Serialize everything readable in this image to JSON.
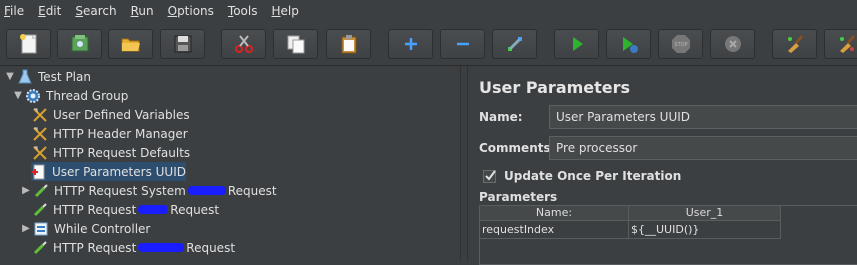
{
  "menu": [
    {
      "mn": "F",
      "rest": "ile"
    },
    {
      "mn": "E",
      "rest": "dit"
    },
    {
      "mn": "S",
      "rest": "earch"
    },
    {
      "mn": "R",
      "rest": "un"
    },
    {
      "mn": "O",
      "rest": "ptions"
    },
    {
      "mn": "T",
      "rest": "ools"
    },
    {
      "mn": "H",
      "rest": "elp"
    }
  ],
  "toolbar_icons": [
    "new-icon",
    "templates-icon",
    "open-icon",
    "save-icon",
    "cut-icon",
    "copy-icon",
    "paste-icon",
    "expand-icon",
    "collapse-icon",
    "toggle-icon",
    "start-icon",
    "start-no-pauses-icon",
    "stop-icon",
    "shutdown-icon",
    "clear-icon",
    "clear-all-icon"
  ],
  "tree": {
    "test_plan": "Test Plan",
    "thread_group": "Thread Group",
    "udv": "User Defined Variables",
    "header_manager": "HTTP Header Manager",
    "request_defaults": "HTTP Request Defaults",
    "user_params": "User Parameters UUID",
    "req1_a": "HTTP Request System ",
    "req1_b": "Request",
    "req2_a": "HTTP Request ",
    "req2_b": "Request",
    "while_controller": "While Controller",
    "req3_a": "HTTP Request ",
    "req3_b": "Request"
  },
  "panel": {
    "title": "User Parameters",
    "name_label": "Name:",
    "name_value": "User Parameters UUID",
    "comments_label": "Comments:",
    "comments_value": "Pre processor",
    "checkbox_label": "Update Once Per Iteration",
    "checkbox_checked": true,
    "params_label": "Parameters",
    "columns": [
      "Name:",
      "User_1"
    ],
    "rows": [
      [
        "requestIndex",
        "${__UUID()}"
      ]
    ]
  }
}
